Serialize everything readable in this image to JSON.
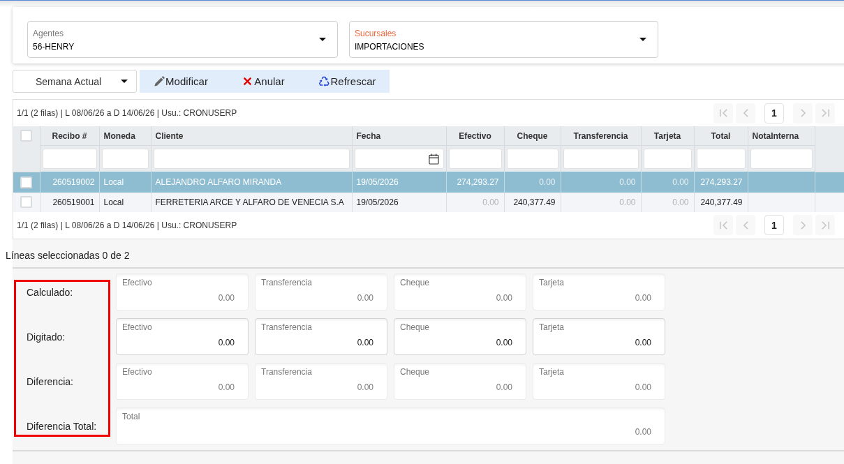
{
  "selectors": [
    {
      "label": "Agentes",
      "value": "56-HENRY",
      "highlighted": false
    },
    {
      "label": "Sucursales",
      "value": "IMPORTACIONES",
      "highlighted": true
    }
  ],
  "toolbar": {
    "period_selector": {
      "value": "Semana Actual"
    },
    "actions": [
      {
        "label": "Modificar",
        "kind": "edit"
      },
      {
        "label": "Anular",
        "kind": "void"
      },
      {
        "label": "Refrescar",
        "kind": "refresh"
      }
    ]
  },
  "grid": {
    "top_bar": {
      "summary": "1/1 (2 filas) | L 08/06/26 a D 14/06/26 | Usu.: CRONUSERP",
      "pager": [
        {
          "kind": "first",
          "disabled": true
        },
        {
          "kind": "previous",
          "disabled": true
        },
        {
          "kind": "page",
          "label": "1",
          "selected": true
        },
        {
          "kind": "next",
          "disabled": true
        },
        {
          "kind": "last",
          "disabled": true
        }
      ]
    },
    "select_all_checked": false,
    "columns": [
      {
        "label": "Recibo #",
        "kind": "number"
      },
      {
        "label": "Moneda",
        "kind": "text"
      },
      {
        "label": "Cliente",
        "kind": "text"
      },
      {
        "label": "Fecha",
        "kind": "date"
      },
      {
        "label": "Efectivo",
        "kind": "amount"
      },
      {
        "label": "Cheque",
        "kind": "amount"
      },
      {
        "label": "Transferencia",
        "kind": "amount"
      },
      {
        "label": "Tarjeta",
        "kind": "amount"
      },
      {
        "label": "Total",
        "kind": "amount"
      },
      {
        "label": "NotaInterna",
        "kind": "text"
      }
    ],
    "rows": [
      {
        "selected": true,
        "checked": false,
        "cells": [
          {
            "text": "260519002",
            "dimmed": false
          },
          {
            "text": "Local",
            "dimmed": false
          },
          {
            "text": "ALEJANDRO ALFARO MIRANDA",
            "dimmed": false
          },
          {
            "text": "19/05/2026",
            "dimmed": false
          },
          {
            "text": "274,293.27",
            "dimmed": false
          },
          {
            "text": "0.00",
            "dimmed": true
          },
          {
            "text": "0.00",
            "dimmed": true
          },
          {
            "text": "0.00",
            "dimmed": true
          },
          {
            "text": "274,293.27",
            "dimmed": false
          }
        ]
      },
      {
        "selected": false,
        "checked": false,
        "cells": [
          {
            "text": "260519001",
            "dimmed": false
          },
          {
            "text": "Local",
            "dimmed": false
          },
          {
            "text": "FERRETERIA ARCE Y ALFARO DE VENECIA S.A",
            "dimmed": false
          },
          {
            "text": "19/05/2026",
            "dimmed": false
          },
          {
            "text": "0.00",
            "dimmed": true
          },
          {
            "text": "240,377.49",
            "dimmed": false
          },
          {
            "text": "0.00",
            "dimmed": true
          },
          {
            "text": "0.00",
            "dimmed": true
          },
          {
            "text": "240,377.49",
            "dimmed": false
          }
        ]
      }
    ],
    "bottom_bar": {
      "summary": "1/1 (2 filas) | L 08/06/26 a D 14/06/26 | Usu.: CRONUSERP",
      "pager": [
        {
          "kind": "first",
          "disabled": true
        },
        {
          "kind": "previous",
          "disabled": true
        },
        {
          "kind": "page",
          "label": "1",
          "selected": true
        },
        {
          "kind": "next",
          "disabled": true
        },
        {
          "kind": "last",
          "disabled": true
        }
      ]
    }
  },
  "selection_status": "Líneas seleccionadas 0 de 2",
  "totals": {
    "highlighted": true,
    "rows": [
      {
        "label": "Calculado:",
        "editable": false,
        "fields": [
          {
            "label": "Efectivo",
            "value": "0.00"
          },
          {
            "label": "Transferencia",
            "value": "0.00"
          },
          {
            "label": "Cheque",
            "value": "0.00"
          },
          {
            "label": "Tarjeta",
            "value": "0.00"
          }
        ]
      },
      {
        "label": "Digitado:",
        "editable": true,
        "fields": [
          {
            "label": "Efectivo",
            "value": "0.00"
          },
          {
            "label": "Transferencia",
            "value": "0.00"
          },
          {
            "label": "Cheque",
            "value": "0.00"
          },
          {
            "label": "Tarjeta",
            "value": "0.00"
          }
        ]
      },
      {
        "label": "Diferencia:",
        "editable": false,
        "fields": [
          {
            "label": "Efectivo",
            "value": "0.00"
          },
          {
            "label": "Transferencia",
            "value": "0.00"
          },
          {
            "label": "Cheque",
            "value": "0.00"
          },
          {
            "label": "Tarjeta",
            "value": "0.00"
          }
        ]
      },
      {
        "label": "Diferencia Total:",
        "editable": false,
        "fields": [
          {
            "label": "Total",
            "value": "0.00"
          }
        ]
      }
    ]
  }
}
